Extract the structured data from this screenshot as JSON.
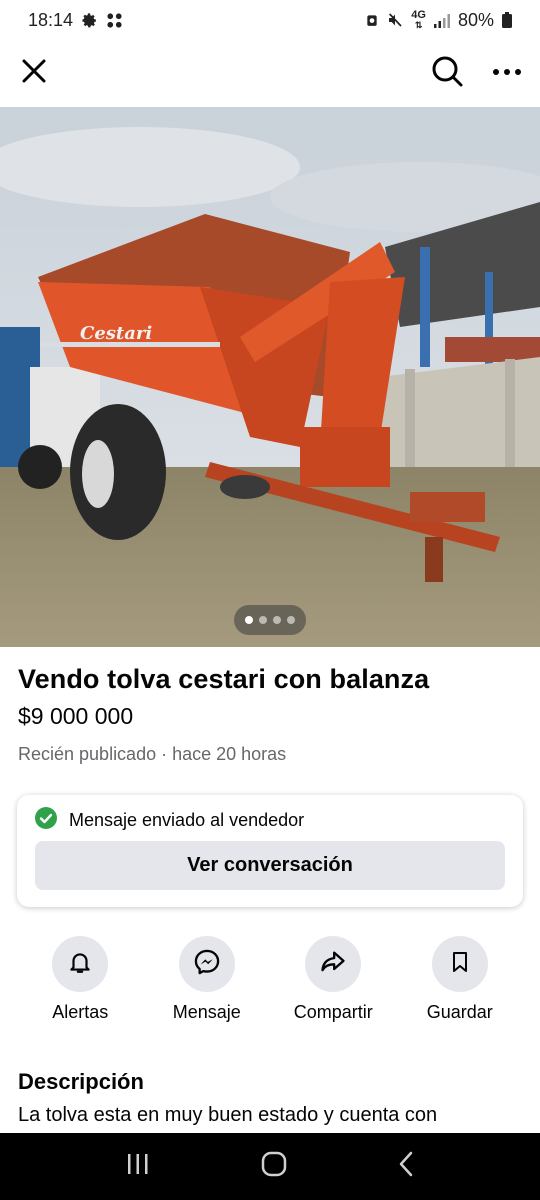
{
  "status_bar": {
    "time": "18:14",
    "battery": "80%",
    "network": "4G",
    "icons": [
      "settings-icon",
      "apps-icon",
      "alarm-icon",
      "mute-icon",
      "network-icon",
      "signal-icon",
      "battery-icon"
    ]
  },
  "top_bar": {
    "icons": [
      "close-icon",
      "search-icon",
      "more-icon"
    ]
  },
  "gallery": {
    "image_count": 4,
    "active_index": 0,
    "painted_text": "Cestari"
  },
  "listing": {
    "title": "Vendo tolva cestari con balanza",
    "price": "$9 000 000",
    "meta": "Recién publicado · hace 20 horas"
  },
  "message_card": {
    "status": "Mensaje enviado al vendedor",
    "button": "Ver conversación",
    "status_color": "#31a24c"
  },
  "actions": [
    {
      "label": "Alertas",
      "icon": "bell-icon"
    },
    {
      "label": "Mensaje",
      "icon": "messenger-icon"
    },
    {
      "label": "Compartir",
      "icon": "share-icon"
    },
    {
      "label": "Guardar",
      "icon": "bookmark-icon"
    }
  ],
  "description": {
    "heading": "Descripción",
    "text": "La tolva esta en muy buen estado y cuenta con"
  },
  "nav_bar": {
    "icons": [
      "recents-icon",
      "home-icon",
      "back-icon"
    ]
  }
}
